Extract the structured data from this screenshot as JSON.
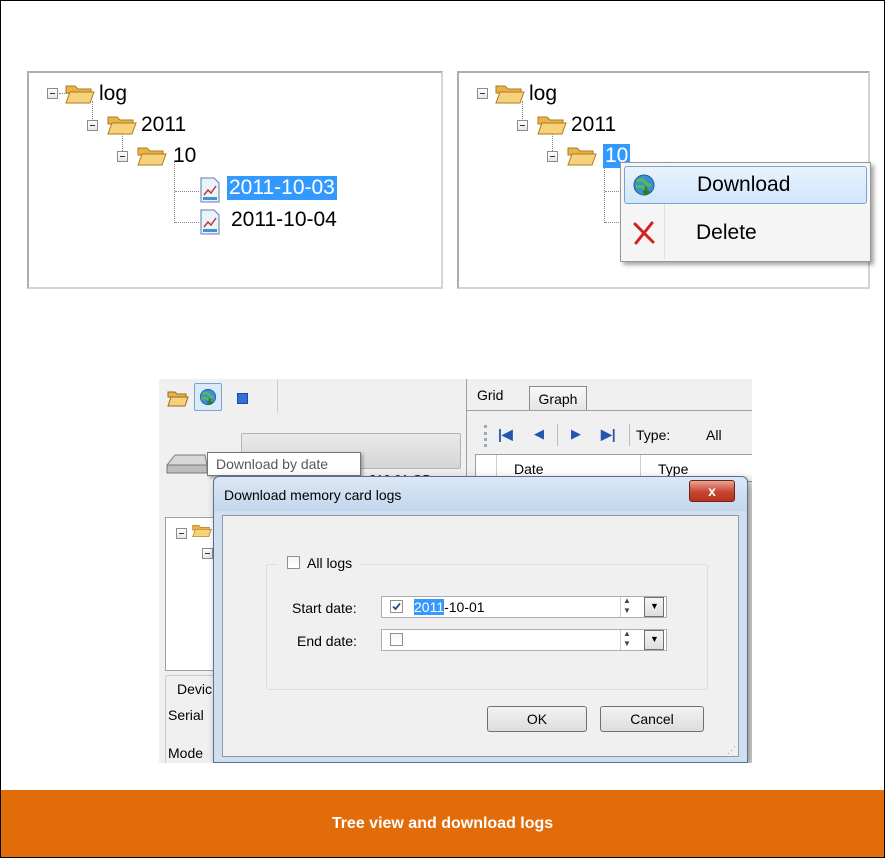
{
  "tree_left": {
    "root": "log",
    "year": "2011",
    "month": "10",
    "files": [
      "2011-10-03",
      "2011-10-04"
    ],
    "selected": "2011-10-03"
  },
  "tree_right": {
    "root": "log",
    "year": "2011",
    "month": "10",
    "context_menu": {
      "download": "Download",
      "delete": "Delete"
    }
  },
  "app": {
    "tabs": {
      "grid": "Grid",
      "graph": "Graph"
    },
    "type_label": "Type:",
    "type_value": "All",
    "grid_headers": {
      "date": "Date",
      "type": "Type"
    },
    "tooltip": "Download by date",
    "drive_text": "210.01 GB",
    "side_labels": {
      "device": "Devic",
      "serial": "Serial",
      "model": "Mode"
    }
  },
  "dialog": {
    "title": "Download memory card logs",
    "all_logs_label": "All logs",
    "all_logs_checked": false,
    "start_label": "Start date:",
    "start_checked": true,
    "start_year": "2011",
    "start_rest": "-10-01",
    "end_label": "End date:",
    "end_checked": false,
    "ok": "OK",
    "cancel": "Cancel",
    "close_glyph": "x"
  },
  "caption": "Tree view and download logs",
  "colors": {
    "caption_bg": "#e36c0a",
    "selection": "#3399ff",
    "close_red": "#c94430"
  }
}
